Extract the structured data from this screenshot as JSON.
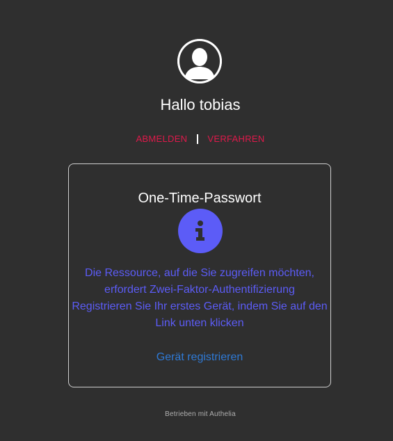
{
  "header": {
    "avatar_icon": "user-avatar-icon",
    "greeting": "Hallo tobias"
  },
  "nav": {
    "logout_label": "ABMELDEN",
    "methods_label": "VERFAHREN",
    "separator": "|"
  },
  "card": {
    "title": "One-Time-Passwort",
    "info_icon": "info-icon",
    "message_line_1": "Die Ressource, auf die Sie zugreifen möchten, erfordert Zwei-Faktor-Authentifizierung",
    "message_line_2": "Registrieren Sie Ihr erstes Gerät, indem Sie auf den Link unten klicken",
    "register_link": "Gerät registrieren"
  },
  "footer": {
    "text": "Betrieben mit Authelia"
  },
  "colors": {
    "background": "#2f2f2f",
    "accent_red": "#e0194b",
    "info_purple": "#5c5cf7",
    "link_blue": "#2f7ad6"
  }
}
